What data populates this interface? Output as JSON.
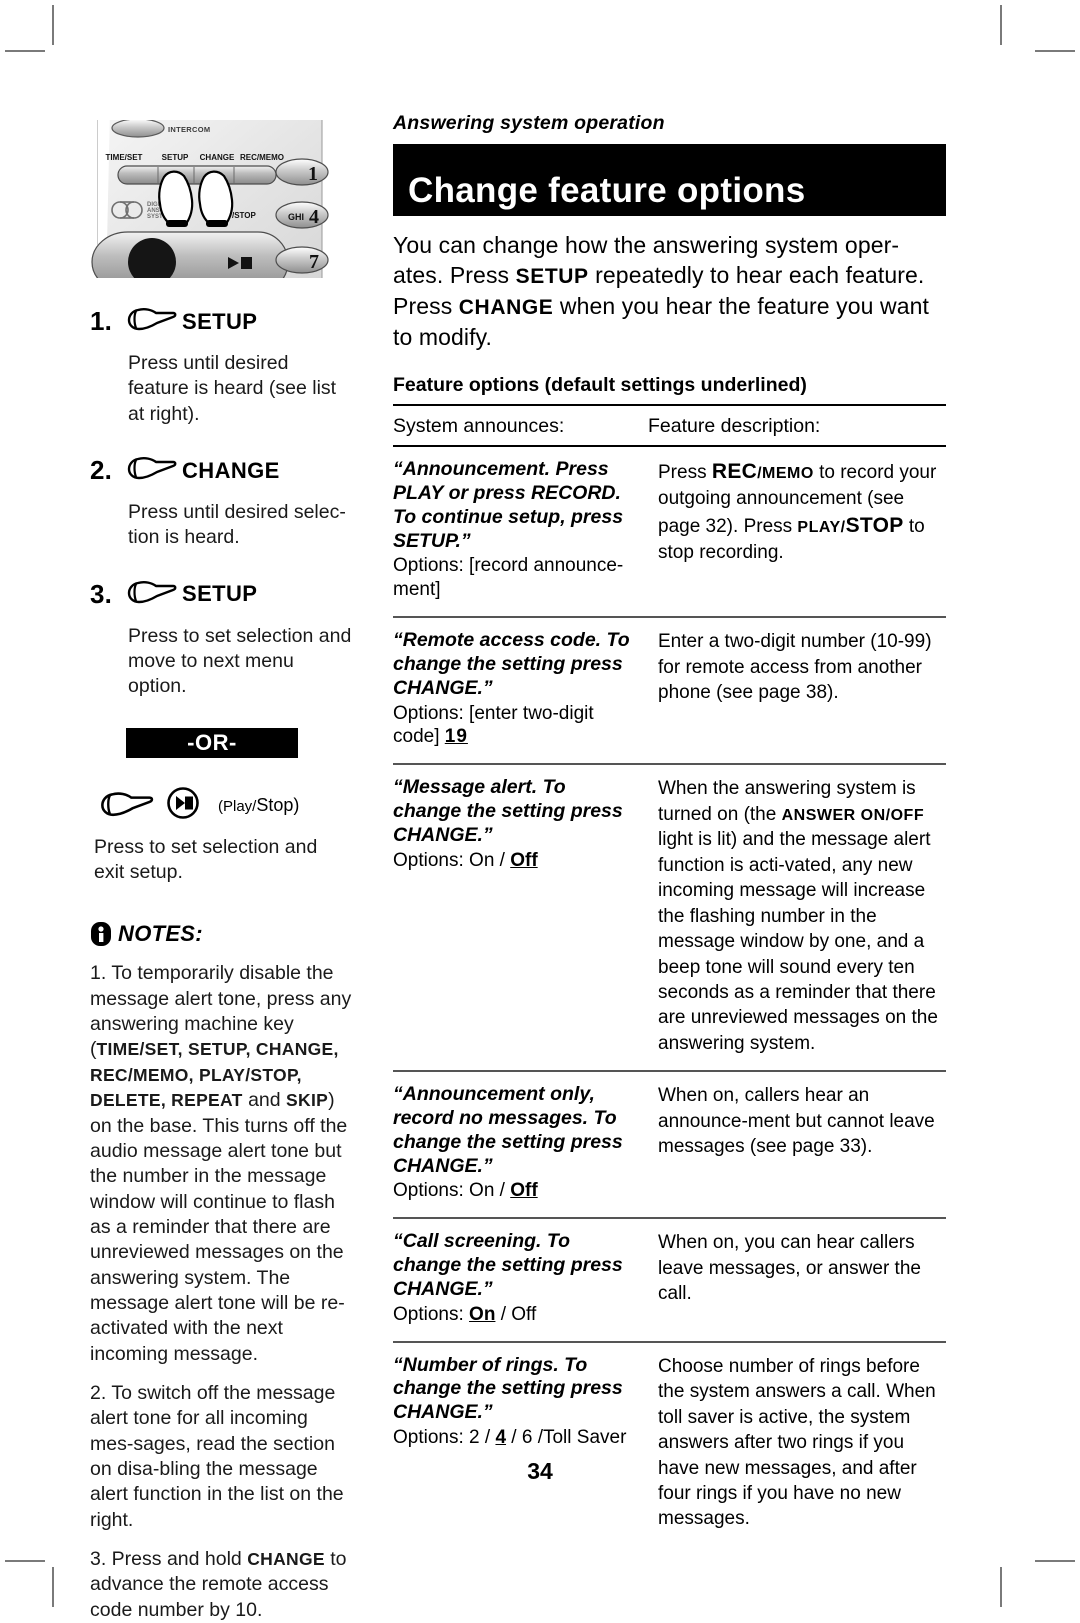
{
  "document": {
    "eyebrow": "Answering system operation",
    "title": "Change feature options",
    "page_number": "34",
    "intro_parts": {
      "p1": "You can change how the answering system oper-ates. Press ",
      "kbd1": "SETUP",
      "p2": " repeatedly to hear each feature. Press ",
      "kbd2": "CHANGE",
      "p3": " when you hear the feature you want to modify."
    }
  },
  "illustration": {
    "name": "base-unit-keypad-illustration",
    "labels": {
      "intercom": "INTERCOM",
      "time_set": "TIME/SET",
      "setup": "SETUP",
      "change": "CHANGE",
      "rec_memo": "REC/MEMO",
      "play_stop": "/STOP",
      "brand_line1": "DIGITAL",
      "brand_line2": "ANSWERING",
      "brand_line3": "SYSTEM",
      "key1": "1",
      "key4": "4",
      "key4_letters": "GHI",
      "key7": "7"
    }
  },
  "steps": [
    {
      "number": "1.",
      "icon": "pointing-hand-icon",
      "label": "SETUP",
      "body": "Press until desired feature is heard (see list at right)."
    },
    {
      "number": "2.",
      "icon": "pointing-hand-icon",
      "label": "CHANGE",
      "body": "Press until desired selec-tion is heard."
    },
    {
      "number": "3.",
      "icon": "pointing-hand-icon",
      "label": "SETUP",
      "body": "Press to set selection and move to next menu option."
    }
  ],
  "or_divider": {
    "label": "-OR-"
  },
  "alt_step": {
    "icon": "pointing-hand-icon",
    "button_icon": "play-stop-icon",
    "caption_small": "(Play/",
    "caption_large": "Stop)",
    "body": "Press to set selection and exit setup."
  },
  "notes": {
    "icon": "info-icon",
    "heading": "NOTES:",
    "items": [
      {
        "lead": "1. To temporarily disable the message alert tone, press any answering machine key (",
        "keys": "TIME/SET, SETUP, CHANGE, REC/MEMO, PLAY/STOP, DELETE, REPEAT",
        "mid": " and ",
        "keys2": "SKIP",
        "tail": ") on the base. This turns off the audio message alert tone but the number in the message window will continue to flash as a reminder that there are unreviewed messages on the answering system. The message alert tone will be re-activated with the next incoming message."
      },
      {
        "text": "2. To switch off the message alert tone for all incoming mes-sages, read the section on disa-bling the message alert function in the list on the right."
      },
      {
        "lead": "3. Press and hold ",
        "keys": "CHANGE",
        "tail": " to advance the remote access code number by 10."
      }
    ]
  },
  "feature_table": {
    "caption": "Feature options (default settings underlined)",
    "headers": {
      "col1": "System announces:",
      "col2": "Feature description:"
    },
    "rows": [
      {
        "announce_italic": "“Announcement. Press PLAY or press RECORD. To continue setup, press SETUP.”",
        "options_label": "Options: ",
        "options_value": "[record announce-ment]",
        "options_default": "",
        "desc_parts": {
          "p1": "Press ",
          "kbd1": "REC",
          "kbd1b": "/MEMO",
          "p2": " to record your outgoing announcement (see page 32). Press ",
          "kbd2": "PLAY/",
          "kbd2b": "STOP",
          "p3": " to stop recording."
        }
      },
      {
        "announce_italic": "“Remote access code. To change the setting press CHANGE.”",
        "options_label": "Options: ",
        "options_value": "[enter two-digit code] ",
        "options_default": "19",
        "desc_parts": {
          "p1": "Enter a two-digit number (10-99) for remote access from another phone (see page 38)."
        }
      },
      {
        "announce_italic": "“Message alert. To change the setting press CHANGE.”",
        "options_label": "Options: ",
        "options_value": "On / ",
        "options_default": "Off",
        "desc_parts": {
          "p1": "When the answering system is turned on (the ",
          "kbd1": "ANSWER ON/OFF",
          "p2": " light is lit) and the message alert function is acti-vated, any new incoming message will increase the flashing number in the message window by one, and a beep tone will sound every ten seconds as a reminder that there are unreviewed messages on the answering system."
        }
      },
      {
        "announce_italic": "“Announcement only, record no messages. To change the setting press CHANGE.”",
        "options_label": "Options: ",
        "options_value": "On / ",
        "options_default": "Off",
        "desc_parts": {
          "p1": "When on, callers hear an announce-ment but cannot leave messages (see page 33)."
        }
      },
      {
        "announce_italic": "“Call screening. To change the setting press CHANGE.”",
        "options_label": "Options: ",
        "options_value": "",
        "options_default": "On",
        "options_after": " / Off",
        "desc_parts": {
          "p1": "When on, you can hear callers leave messages, or answer the call."
        }
      },
      {
        "announce_italic": "“Number of rings. To change the setting press CHANGE.”",
        "options_label": "Options: ",
        "options_value": "2 / ",
        "options_default": "4",
        "options_after": " / 6 /Toll Saver",
        "desc_parts": {
          "p1": "Choose number of rings before the system answers a call. When toll saver is active, the system answers after two rings if you have new messages, and after four rings if you have no new messages."
        }
      }
    ]
  },
  "colors": {
    "ink": "#000000",
    "paper": "#ffffff",
    "rule": "#555555",
    "cropmark": "#7a7a7a"
  }
}
